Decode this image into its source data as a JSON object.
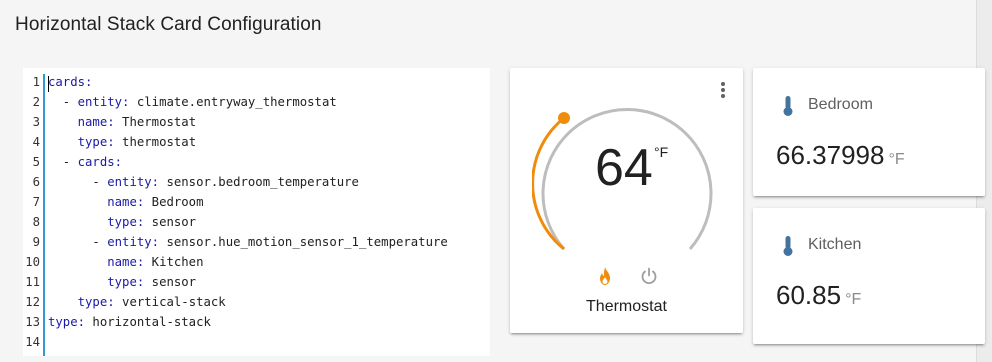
{
  "header": {
    "title": "Horizontal Stack Card Configuration"
  },
  "editor": {
    "lines": [
      {
        "n": "1",
        "indent": "",
        "key": "cards:",
        "val": ""
      },
      {
        "n": "2",
        "indent": "  - ",
        "key": "entity:",
        "val": " climate.entryway_thermostat"
      },
      {
        "n": "3",
        "indent": "    ",
        "key": "name:",
        "val": " Thermostat"
      },
      {
        "n": "4",
        "indent": "    ",
        "key": "type:",
        "val": " thermostat"
      },
      {
        "n": "5",
        "indent": "  - ",
        "key": "cards:",
        "val": ""
      },
      {
        "n": "6",
        "indent": "      - ",
        "key": "entity:",
        "val": " sensor.bedroom_temperature"
      },
      {
        "n": "7",
        "indent": "        ",
        "key": "name:",
        "val": " Bedroom"
      },
      {
        "n": "8",
        "indent": "        ",
        "key": "type:",
        "val": " sensor"
      },
      {
        "n": "9",
        "indent": "      - ",
        "key": "entity:",
        "val": " sensor.hue_motion_sensor_1_temperature"
      },
      {
        "n": "10",
        "indent": "        ",
        "key": "name:",
        "val": " Kitchen"
      },
      {
        "n": "11",
        "indent": "        ",
        "key": "type:",
        "val": " sensor"
      },
      {
        "n": "12",
        "indent": "    ",
        "key": "type:",
        "val": " vertical-stack"
      },
      {
        "n": "13",
        "indent": "",
        "key": "type:",
        "val": " horizontal-stack"
      },
      {
        "n": "14",
        "indent": "",
        "key": "",
        "val": ""
      }
    ]
  },
  "thermostat": {
    "temperature": "64",
    "unit": "°F",
    "name": "Thermostat",
    "icons": [
      "flame-icon",
      "power-icon",
      "more-vert-icon"
    ],
    "colors": {
      "arc_active": "#f08c0c",
      "arc_inactive": "#bdbdbd",
      "flame": "#f08c0c",
      "power": "#9e9e9e"
    }
  },
  "sensors": {
    "bedroom": {
      "name": "Bedroom",
      "value": "66.37998",
      "unit": "°F",
      "icon": "thermometer-icon"
    },
    "kitchen": {
      "name": "Kitchen",
      "value": "60.85",
      "unit": "°F",
      "icon": "thermometer-icon"
    },
    "icon_color": "#44739e"
  },
  "colors": {
    "gutter_accent": "#2f9bd3",
    "yaml_key": "#1a1aa6"
  }
}
